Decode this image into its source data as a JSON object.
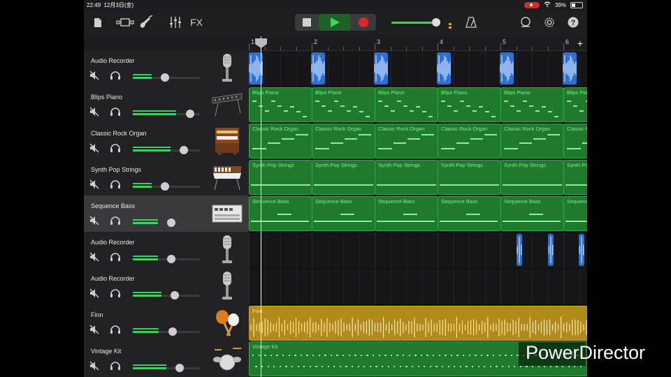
{
  "status": {
    "time": "22:49",
    "date": "12月3日(金)",
    "battery": "39%",
    "battery_level": 0.39
  },
  "toolbar": {
    "icons": [
      "browser-icon",
      "tracks-view-icon",
      "instrument-icon",
      "mixer-icon",
      "fx-icon",
      "stop-icon",
      "play-icon",
      "record-icon",
      "metronome-icon",
      "loop-icon",
      "settings-icon",
      "help-icon"
    ],
    "fx_label": "FX",
    "master_volume": 0.93
  },
  "ruler": {
    "bars": [
      "1",
      "2",
      "3",
      "4",
      "5",
      "6"
    ],
    "add_label": "+"
  },
  "tracks": [
    {
      "name": "Audio Recorder",
      "volume": 0.48,
      "instrument": "microphone-icon",
      "selected": false
    },
    {
      "name": "Blips Piano",
      "volume": 0.85,
      "instrument": "keyboard-icon",
      "selected": false
    },
    {
      "name": "Classic Rock Organ",
      "volume": 0.76,
      "instrument": "organ-icon",
      "selected": false
    },
    {
      "name": "Synth Pop Strings",
      "volume": 0.48,
      "instrument": "synth-icon",
      "selected": false
    },
    {
      "name": "Sequence Bass",
      "volume": 0.57,
      "instrument": "sequencer-icon",
      "selected": true
    },
    {
      "name": "Audio Recorder",
      "volume": 0.57,
      "instrument": "microphone-icon",
      "selected": false
    },
    {
      "name": "Audio Recorder",
      "volume": 0.63,
      "instrument": "microphone-icon",
      "selected": false
    },
    {
      "name": "Finn",
      "volume": 0.59,
      "instrument": "maracas-icon",
      "selected": false
    },
    {
      "name": "Vintage Kit",
      "volume": 0.7,
      "instrument": "drumkit-icon",
      "selected": false
    }
  ],
  "regions": {
    "blips": "Blips Piano",
    "organ": "Classic Rock Organ",
    "strings": "Synth Pop Strings",
    "bass": "Sequence Bass",
    "finn": "Finn",
    "kit": "Vintage Kit"
  },
  "colors": {
    "accent": "#3cd45a",
    "region_green": "#1f7a2e",
    "audio_blue": "#2f6fd0",
    "finn_gold": "#b08a1c",
    "record": "#e0262a"
  },
  "watermark": "PowerDirector"
}
